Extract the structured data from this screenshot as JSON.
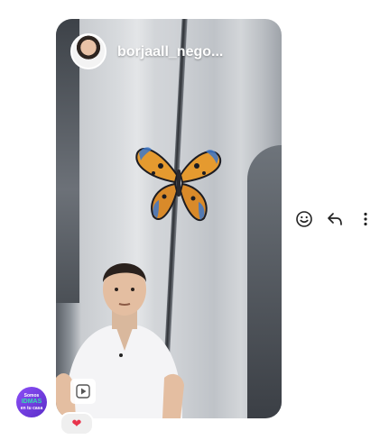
{
  "story": {
    "username": "borjaall_nego...",
    "avatar_icon": "profile-avatar",
    "play_icon": "play-icon"
  },
  "actions": [
    {
      "name": "react",
      "icon": "smiley-icon"
    },
    {
      "name": "reply",
      "icon": "reply-arrow-icon"
    },
    {
      "name": "more",
      "icon": "more-vertical-icon"
    }
  ],
  "sender": {
    "lines": [
      "Somos",
      "IDMAS",
      "en tu casa"
    ]
  },
  "reaction": {
    "emoji": "❤"
  },
  "colors": {
    "accent": "#e8334b",
    "sender_bg": "#7a41e8",
    "sender_text_accent": "#30e0b0"
  }
}
